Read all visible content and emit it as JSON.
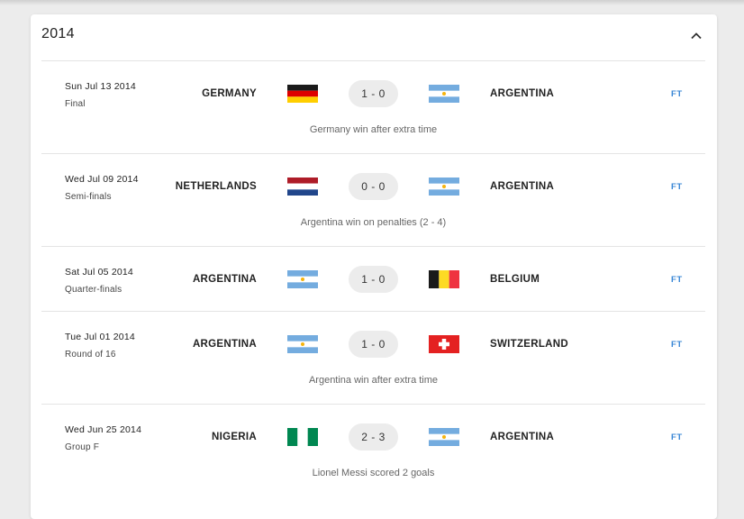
{
  "section": {
    "year": "2014"
  },
  "icons": {
    "collapse": "chevron-up-icon"
  },
  "colors": {
    "status": "#3a87d6",
    "score_pill": "#ececec"
  },
  "matches": [
    {
      "date": "Sun Jul 13 2014",
      "stage": "Final",
      "home": "GERMANY",
      "home_flag": "germany",
      "score": "1 - 0",
      "away": "ARGENTINA",
      "away_flag": "argentina",
      "status": "FT",
      "note": "Germany win after extra time"
    },
    {
      "date": "Wed Jul 09 2014",
      "stage": "Semi-finals",
      "home": "NETHERLANDS",
      "home_flag": "netherlands",
      "score": "0 - 0",
      "away": "ARGENTINA",
      "away_flag": "argentina",
      "status": "FT",
      "note": "Argentina win on penalties (2 - 4)"
    },
    {
      "date": "Sat Jul 05 2014",
      "stage": "Quarter-finals",
      "home": "ARGENTINA",
      "home_flag": "argentina",
      "score": "1 - 0",
      "away": "BELGIUM",
      "away_flag": "belgium",
      "status": "FT",
      "note": ""
    },
    {
      "date": "Tue Jul 01 2014",
      "stage": "Round of 16",
      "home": "ARGENTINA",
      "home_flag": "argentina",
      "score": "1 - 0",
      "away": "SWITZERLAND",
      "away_flag": "switzerland",
      "status": "FT",
      "note": "Argentina win after extra time"
    },
    {
      "date": "Wed Jun 25 2014",
      "stage": "Group F",
      "home": "NIGERIA",
      "home_flag": "nigeria",
      "score": "2 - 3",
      "away": "ARGENTINA",
      "away_flag": "argentina",
      "status": "FT",
      "note": "Lionel Messi scored 2 goals"
    }
  ]
}
